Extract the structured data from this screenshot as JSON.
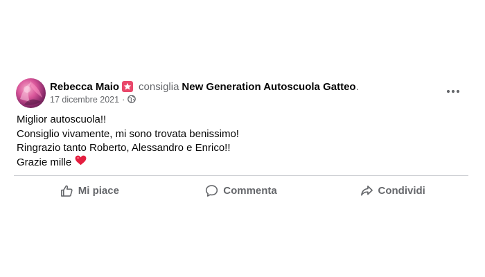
{
  "post": {
    "author": "Rebecca Maio",
    "verb": "consiglia",
    "page_name": "New Generation Autoscuola Gatteo",
    "end_punct": ".",
    "date": "17 dicembre 2021",
    "meta_separator": "·",
    "audience_icon": "globe-icon",
    "badge_icon": "star-icon",
    "badge_color": "#e9486b",
    "body_lines": [
      "Miglior autoscuola!!",
      "Consiglio vivamente, mi sono trovata benissimo!",
      "Ringrazio tanto Roberto, Alessandro e Enrico!!",
      "Grazie mille"
    ],
    "emoji": "red-heart-icon"
  },
  "actions": {
    "like": {
      "label": "Mi piace",
      "icon": "thumbs-up-icon"
    },
    "comment": {
      "label": "Commenta",
      "icon": "comment-icon"
    },
    "share": {
      "label": "Condividi",
      "icon": "share-icon"
    }
  },
  "colors": {
    "text_primary": "#050505",
    "text_secondary": "#65676b",
    "divider": "#ced0d4",
    "heart": "#e41e3f"
  }
}
